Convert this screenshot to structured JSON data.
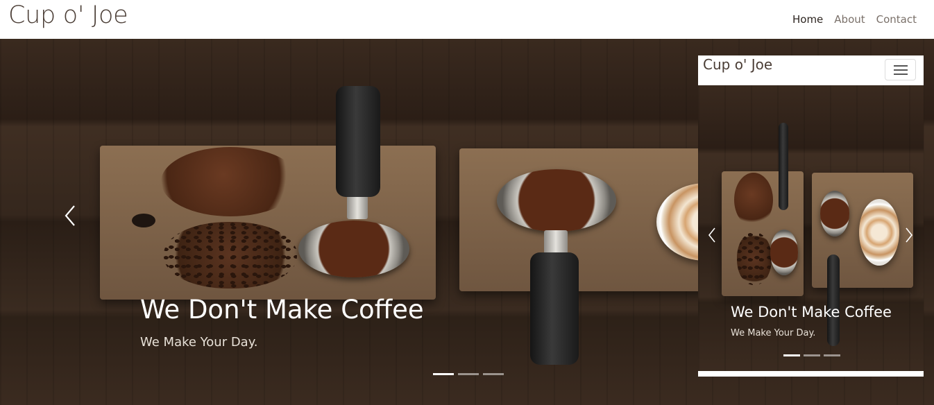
{
  "navbar": {
    "brand": "Cup o' Joe",
    "links": [
      {
        "label": "Home",
        "active": true
      },
      {
        "label": "About",
        "active": false
      },
      {
        "label": "Contact",
        "active": false
      }
    ]
  },
  "carousel": {
    "title": "We Don't Make Coffee",
    "subtitle": "We Make Your Day.",
    "prev_icon": "chevron-left-icon",
    "next_icon": "chevron-right-icon",
    "slide_count": 3,
    "active_slide": 1
  },
  "mobile_preview": {
    "brand": "Cup o' Joe",
    "menu_icon": "hamburger-icon",
    "title": "We Don't Make Coffee",
    "subtitle": "We Make Your Day."
  },
  "colors": {
    "brand_text": "#4a3d35",
    "nav_active": "#2d2520",
    "nav_inactive": "#7a7069",
    "caption_text": "#ffffff",
    "wood_dark": "#2b1e16"
  }
}
